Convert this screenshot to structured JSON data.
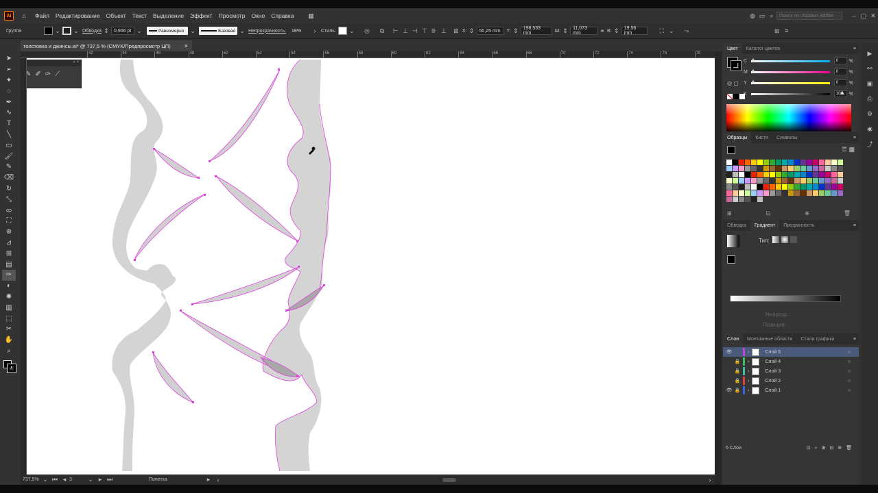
{
  "app": {
    "logo": "Ai",
    "home_icon": "home-icon"
  },
  "menu": [
    "Файл",
    "Редактирование",
    "Объект",
    "Текст",
    "Выделение",
    "Эффект",
    "Просмотр",
    "Окно",
    "Справка"
  ],
  "help_search_placeholder": "Поиск по справке Adobe",
  "control": {
    "selection_type": "Группа",
    "stroke_label": "Обводка",
    "stroke_weight": "0,906 pt",
    "profile": "Равномерно",
    "brush": "Базовая",
    "opacity_label": "Непрозрачность:",
    "opacity_value": "18%",
    "style_label": "Стиль:",
    "x_label": "X:",
    "x_value": "50,25 mm",
    "y_label": "Y:",
    "y_value": "198,533 mm",
    "w_label": "Ш:",
    "w_value": "11,073 mm",
    "h_label": "В:",
    "h_value": "19,56 mm"
  },
  "doc_tab": {
    "title": "толстовка и джинсы.ai* @ 737,5 % (CMYK/Предпросмотр ЦП)",
    "close": "×"
  },
  "ruler_top_ticks": [
    "42",
    "44",
    "46",
    "48",
    "50",
    "52",
    "54",
    "56",
    "58",
    "60",
    "62",
    "64",
    "66",
    "68",
    "70",
    "72",
    "74",
    "76",
    "78"
  ],
  "status": {
    "zoom": "737,5%",
    "artboard": "3",
    "tool": "Пипетка"
  },
  "color_panel": {
    "tabs": [
      "Цвет",
      "Каталог цветов"
    ],
    "channels": [
      {
        "label": "C",
        "value": "0",
        "unit": "%"
      },
      {
        "label": "M",
        "value": "0",
        "unit": "%"
      },
      {
        "label": "Y",
        "value": "0",
        "unit": "%"
      },
      {
        "label": "K",
        "value": "100",
        "unit": "%"
      }
    ]
  },
  "swatch_panel": {
    "tabs": [
      "Образцы",
      "Кисти",
      "Символы"
    ]
  },
  "gradient_panel": {
    "tabs": [
      "Обводка",
      "Градиент",
      "Прозрачность"
    ],
    "type_label": "Тип:",
    "opacity_label": "Непрозр.:",
    "position_label": "Позиция:"
  },
  "layers_panel": {
    "tabs": [
      "Слои",
      "Монтажные области",
      "Стили графики"
    ],
    "layers": [
      {
        "name": "Слой 5",
        "color": "#c040e0",
        "selected": true,
        "visible": true,
        "locked": false
      },
      {
        "name": "Слой 4",
        "color": "#40c060",
        "selected": false,
        "visible": false,
        "locked": true
      },
      {
        "name": "Слой 3",
        "color": "#40c0a0",
        "selected": false,
        "visible": false,
        "locked": true
      },
      {
        "name": "Слой 2",
        "color": "#e04040",
        "selected": false,
        "visible": false,
        "locked": true
      },
      {
        "name": "Слой 1",
        "color": "#4060e0",
        "selected": false,
        "visible": true,
        "locked": true
      }
    ],
    "footer": "5 Слои"
  },
  "colors": {
    "accent_path": "#e040e0",
    "ui_bg": "#323232",
    "canvas": "#ffffff",
    "shape_fill": "#d4d4d4"
  }
}
